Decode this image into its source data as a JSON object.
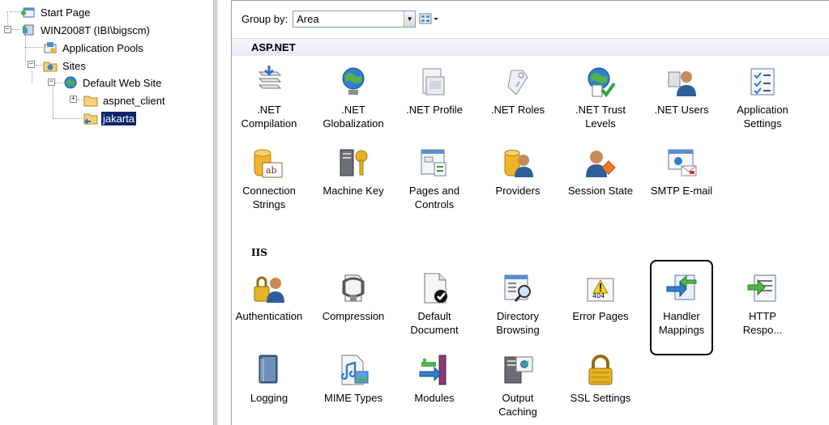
{
  "tree": {
    "items": [
      {
        "label": "Start Page",
        "icon": "start-page-icon"
      },
      {
        "label": "WIN2008T (IBI\\bigscm)",
        "icon": "server-icon"
      },
      {
        "label": "Application Pools",
        "icon": "app-pools-icon"
      },
      {
        "label": "Sites",
        "icon": "sites-folder-icon"
      },
      {
        "label": "Default Web Site",
        "icon": "globe-icon"
      },
      {
        "label": "aspnet_client",
        "icon": "folder-icon"
      },
      {
        "label": "jakarta",
        "icon": "folder-icon",
        "selected": true
      }
    ]
  },
  "toolbar": {
    "group_by_label": "Group by:",
    "group_by_value": "Area"
  },
  "groups": [
    {
      "title": "ASP.NET",
      "items": [
        {
          "label": ".NET\nCompilation",
          "icon": "net-compilation-icon"
        },
        {
          "label": ".NET\nGlobalization",
          "icon": "net-globalization-icon"
        },
        {
          "label": ".NET Profile",
          "icon": "net-profile-icon"
        },
        {
          "label": ".NET Roles",
          "icon": "net-roles-icon"
        },
        {
          "label": ".NET Trust\nLevels",
          "icon": "net-trust-levels-icon"
        },
        {
          "label": ".NET Users",
          "icon": "net-users-icon"
        },
        {
          "label": "Application\nSettings",
          "icon": "application-settings-icon"
        },
        {
          "label": "Connection\nStrings",
          "icon": "connection-strings-icon"
        },
        {
          "label": "Machine Key",
          "icon": "machine-key-icon"
        },
        {
          "label": "Pages and\nControls",
          "icon": "pages-controls-icon"
        },
        {
          "label": "Providers",
          "icon": "providers-icon"
        },
        {
          "label": "Session State",
          "icon": "session-state-icon"
        },
        {
          "label": "SMTP E-mail",
          "icon": "smtp-email-icon"
        }
      ]
    },
    {
      "title": "IIS",
      "items": [
        {
          "label": "Authentication",
          "icon": "authentication-icon"
        },
        {
          "label": "Compression",
          "icon": "compression-icon"
        },
        {
          "label": "Default\nDocument",
          "icon": "default-document-icon"
        },
        {
          "label": "Directory\nBrowsing",
          "icon": "directory-browsing-icon"
        },
        {
          "label": "Error Pages",
          "icon": "error-pages-icon",
          "badge": "404"
        },
        {
          "label": "Handler\nMappings",
          "icon": "handler-mappings-icon",
          "focused": true
        },
        {
          "label": "HTTP\nRespo...",
          "icon": "http-response-icon"
        },
        {
          "label": "Logging",
          "icon": "logging-icon"
        },
        {
          "label": "MIME Types",
          "icon": "mime-types-icon"
        },
        {
          "label": "Modules",
          "icon": "modules-icon"
        },
        {
          "label": "Output\nCaching",
          "icon": "output-caching-icon"
        },
        {
          "label": "SSL Settings",
          "icon": "ssl-settings-icon"
        }
      ]
    }
  ],
  "colors": {
    "selection": "#0a246a",
    "header_bg": "#e9edf1"
  }
}
